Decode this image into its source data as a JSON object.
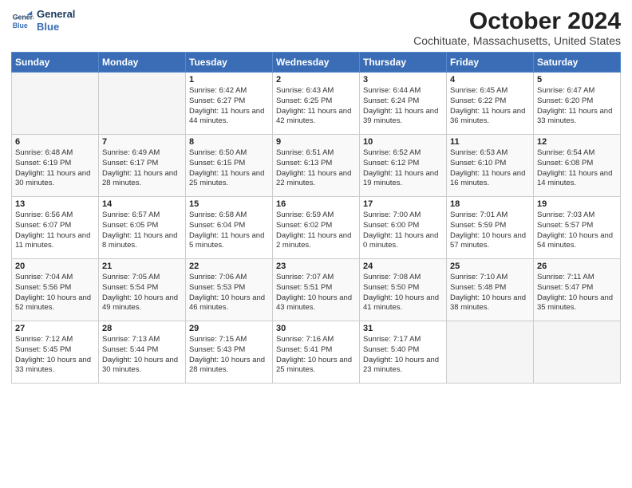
{
  "logo": {
    "line1": "General",
    "line2": "Blue"
  },
  "title": "October 2024",
  "location": "Cochituate, Massachusetts, United States",
  "weekdays": [
    "Sunday",
    "Monday",
    "Tuesday",
    "Wednesday",
    "Thursday",
    "Friday",
    "Saturday"
  ],
  "weeks": [
    [
      {
        "day": "",
        "content": ""
      },
      {
        "day": "",
        "content": ""
      },
      {
        "day": "1",
        "sunrise": "6:42 AM",
        "sunset": "6:27 PM",
        "daylight": "11 hours and 44 minutes."
      },
      {
        "day": "2",
        "sunrise": "6:43 AM",
        "sunset": "6:25 PM",
        "daylight": "11 hours and 42 minutes."
      },
      {
        "day": "3",
        "sunrise": "6:44 AM",
        "sunset": "6:24 PM",
        "daylight": "11 hours and 39 minutes."
      },
      {
        "day": "4",
        "sunrise": "6:45 AM",
        "sunset": "6:22 PM",
        "daylight": "11 hours and 36 minutes."
      },
      {
        "day": "5",
        "sunrise": "6:47 AM",
        "sunset": "6:20 PM",
        "daylight": "11 hours and 33 minutes."
      }
    ],
    [
      {
        "day": "6",
        "sunrise": "6:48 AM",
        "sunset": "6:19 PM",
        "daylight": "11 hours and 30 minutes."
      },
      {
        "day": "7",
        "sunrise": "6:49 AM",
        "sunset": "6:17 PM",
        "daylight": "11 hours and 28 minutes."
      },
      {
        "day": "8",
        "sunrise": "6:50 AM",
        "sunset": "6:15 PM",
        "daylight": "11 hours and 25 minutes."
      },
      {
        "day": "9",
        "sunrise": "6:51 AM",
        "sunset": "6:13 PM",
        "daylight": "11 hours and 22 minutes."
      },
      {
        "day": "10",
        "sunrise": "6:52 AM",
        "sunset": "6:12 PM",
        "daylight": "11 hours and 19 minutes."
      },
      {
        "day": "11",
        "sunrise": "6:53 AM",
        "sunset": "6:10 PM",
        "daylight": "11 hours and 16 minutes."
      },
      {
        "day": "12",
        "sunrise": "6:54 AM",
        "sunset": "6:08 PM",
        "daylight": "11 hours and 14 minutes."
      }
    ],
    [
      {
        "day": "13",
        "sunrise": "6:56 AM",
        "sunset": "6:07 PM",
        "daylight": "11 hours and 11 minutes."
      },
      {
        "day": "14",
        "sunrise": "6:57 AM",
        "sunset": "6:05 PM",
        "daylight": "11 hours and 8 minutes."
      },
      {
        "day": "15",
        "sunrise": "6:58 AM",
        "sunset": "6:04 PM",
        "daylight": "11 hours and 5 minutes."
      },
      {
        "day": "16",
        "sunrise": "6:59 AM",
        "sunset": "6:02 PM",
        "daylight": "11 hours and 2 minutes."
      },
      {
        "day": "17",
        "sunrise": "7:00 AM",
        "sunset": "6:00 PM",
        "daylight": "11 hours and 0 minutes."
      },
      {
        "day": "18",
        "sunrise": "7:01 AM",
        "sunset": "5:59 PM",
        "daylight": "10 hours and 57 minutes."
      },
      {
        "day": "19",
        "sunrise": "7:03 AM",
        "sunset": "5:57 PM",
        "daylight": "10 hours and 54 minutes."
      }
    ],
    [
      {
        "day": "20",
        "sunrise": "7:04 AM",
        "sunset": "5:56 PM",
        "daylight": "10 hours and 52 minutes."
      },
      {
        "day": "21",
        "sunrise": "7:05 AM",
        "sunset": "5:54 PM",
        "daylight": "10 hours and 49 minutes."
      },
      {
        "day": "22",
        "sunrise": "7:06 AM",
        "sunset": "5:53 PM",
        "daylight": "10 hours and 46 minutes."
      },
      {
        "day": "23",
        "sunrise": "7:07 AM",
        "sunset": "5:51 PM",
        "daylight": "10 hours and 43 minutes."
      },
      {
        "day": "24",
        "sunrise": "7:08 AM",
        "sunset": "5:50 PM",
        "daylight": "10 hours and 41 minutes."
      },
      {
        "day": "25",
        "sunrise": "7:10 AM",
        "sunset": "5:48 PM",
        "daylight": "10 hours and 38 minutes."
      },
      {
        "day": "26",
        "sunrise": "7:11 AM",
        "sunset": "5:47 PM",
        "daylight": "10 hours and 35 minutes."
      }
    ],
    [
      {
        "day": "27",
        "sunrise": "7:12 AM",
        "sunset": "5:45 PM",
        "daylight": "10 hours and 33 minutes."
      },
      {
        "day": "28",
        "sunrise": "7:13 AM",
        "sunset": "5:44 PM",
        "daylight": "10 hours and 30 minutes."
      },
      {
        "day": "29",
        "sunrise": "7:15 AM",
        "sunset": "5:43 PM",
        "daylight": "10 hours and 28 minutes."
      },
      {
        "day": "30",
        "sunrise": "7:16 AM",
        "sunset": "5:41 PM",
        "daylight": "10 hours and 25 minutes."
      },
      {
        "day": "31",
        "sunrise": "7:17 AM",
        "sunset": "5:40 PM",
        "daylight": "10 hours and 23 minutes."
      },
      {
        "day": "",
        "content": ""
      },
      {
        "day": "",
        "content": ""
      }
    ]
  ]
}
